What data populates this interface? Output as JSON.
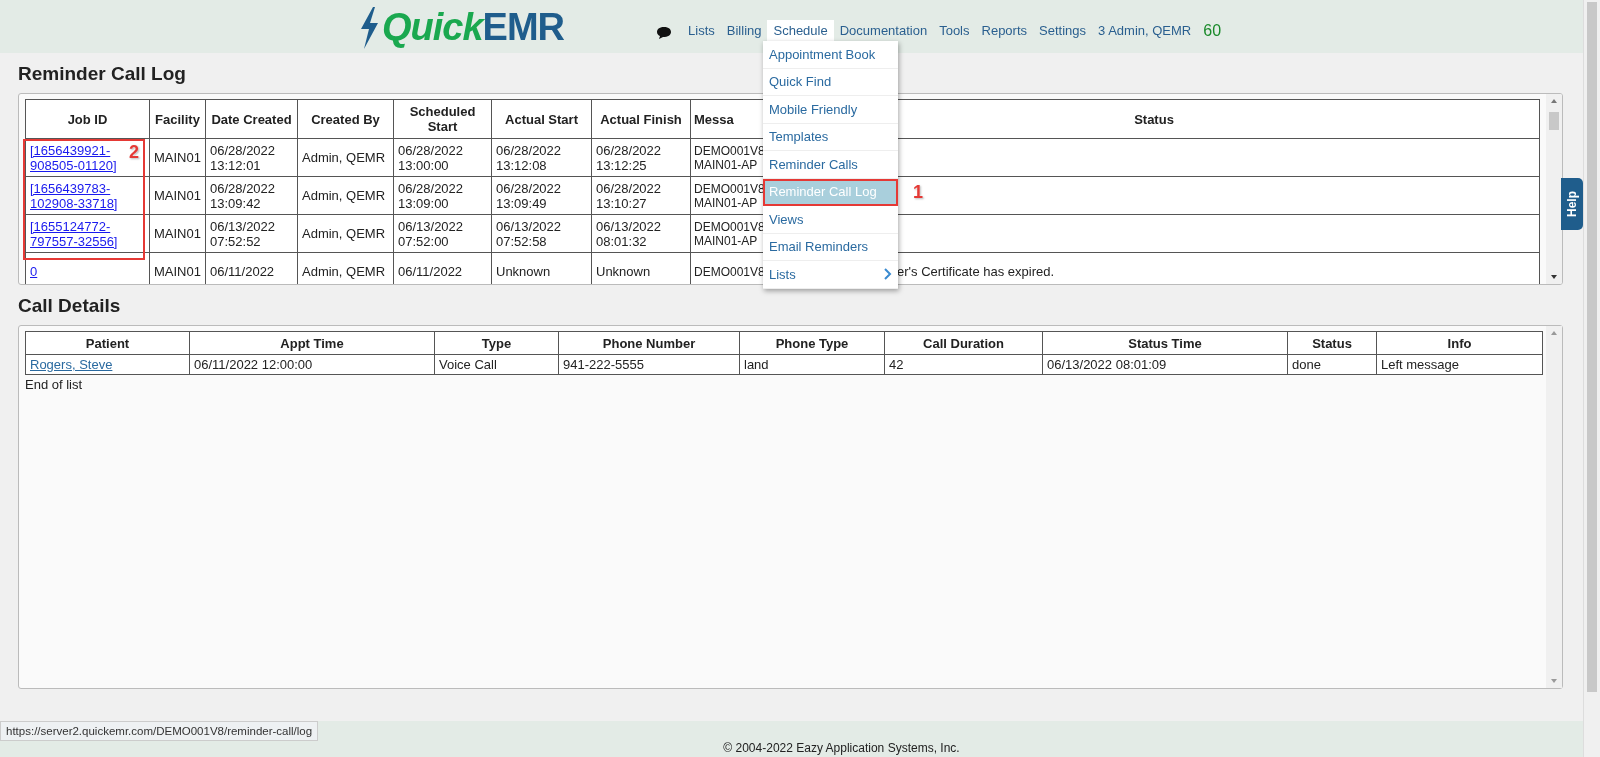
{
  "header": {
    "logo": {
      "part_1": "Quick",
      "part_2": "EMR"
    },
    "nav": [
      {
        "label": "Lists",
        "selected": false
      },
      {
        "label": "Billing",
        "selected": false
      },
      {
        "label": "Schedule",
        "selected": true
      },
      {
        "label": "Documentation",
        "selected": false
      },
      {
        "label": "Tools",
        "selected": false
      },
      {
        "label": "Reports",
        "selected": false
      },
      {
        "label": "Settings",
        "selected": false
      },
      {
        "label": "3 Admin, QEMR",
        "selected": false
      }
    ],
    "counter": "60"
  },
  "menu": {
    "items": [
      {
        "label": "Appointment Book",
        "selected": false
      },
      {
        "label": "Quick Find",
        "selected": false
      },
      {
        "label": "Mobile Friendly",
        "selected": false
      },
      {
        "label": "Templates",
        "selected": false
      },
      {
        "label": "Reminder Calls",
        "selected": false
      },
      {
        "label": "Reminder Call Log",
        "selected": true,
        "annotation": "1"
      },
      {
        "label": "Views",
        "selected": false
      },
      {
        "label": "Email Reminders",
        "selected": false
      },
      {
        "label": "Lists",
        "selected": false,
        "submenu": true
      }
    ]
  },
  "log": {
    "title": "Reminder Call Log",
    "annotation": "2",
    "columns": [
      "Job ID",
      "Facility",
      "Date Created",
      "Created By",
      "Scheduled Start",
      "Actual Start",
      "Actual Finish",
      "Messa",
      "Status"
    ],
    "rows": [
      {
        "cells": [
          "[1656439921-908505-01120]",
          "MAIN01",
          [
            "06/28/2022",
            "13:12:01"
          ],
          "Admin, QEMR",
          [
            "06/28/2022",
            "13:00:00"
          ],
          [
            "06/28/2022",
            "13:12:08"
          ],
          [
            "06/28/2022",
            "13:12:25"
          ],
          [
            "DEMO001V8",
            "MAIN01-AP"
          ],
          ""
        ]
      },
      {
        "cells": [
          "[1656439783-102908-33718]",
          "MAIN01",
          [
            "06/28/2022",
            "13:09:42"
          ],
          "Admin, QEMR",
          [
            "06/28/2022",
            "13:09:00"
          ],
          [
            "06/28/2022",
            "13:09:49"
          ],
          [
            "06/28/2022",
            "13:10:27"
          ],
          [
            "DEMO001V8",
            "MAIN01-AP"
          ],
          ""
        ]
      },
      {
        "cells": [
          "[1655124772-797557-32556]",
          "MAIN01",
          [
            "06/13/2022",
            "07:52:52"
          ],
          "Admin, QEMR",
          [
            "06/13/2022",
            "07:52:00"
          ],
          [
            "06/13/2022",
            "07:52:58"
          ],
          [
            "06/13/2022",
            "08:01:32"
          ],
          [
            "DEMO001V8",
            "MAIN01-AP"
          ],
          ""
        ]
      },
      {
        "cells": [
          "0",
          "MAIN01",
          "06/11/2022",
          "Admin, QEMR",
          "06/11/2022",
          "Unknown",
          "Unknown",
          "DEMO001V8",
          "er's Certificate has expired."
        ]
      }
    ]
  },
  "details": {
    "title": "Call Details",
    "columns": [
      "Patient",
      "Appt Time",
      "Type",
      "Phone Number",
      "Phone Type",
      "Call Duration",
      "Status Time",
      "Status",
      "Info"
    ],
    "rows": [
      {
        "cells": [
          "Rogers, Steve",
          "06/11/2022 12:00:00",
          "Voice Call",
          "941-222-5555",
          "land",
          "42",
          "06/13/2022 08:01:09",
          "done",
          "Left message"
        ]
      }
    ],
    "end_note": "End of list"
  },
  "help_tab": "Help",
  "status_url": "https://server2.quickemr.com/DEMO001V8/reminder-call/log",
  "footer": "© 2004-2022 Eazy Application Systems, Inc."
}
